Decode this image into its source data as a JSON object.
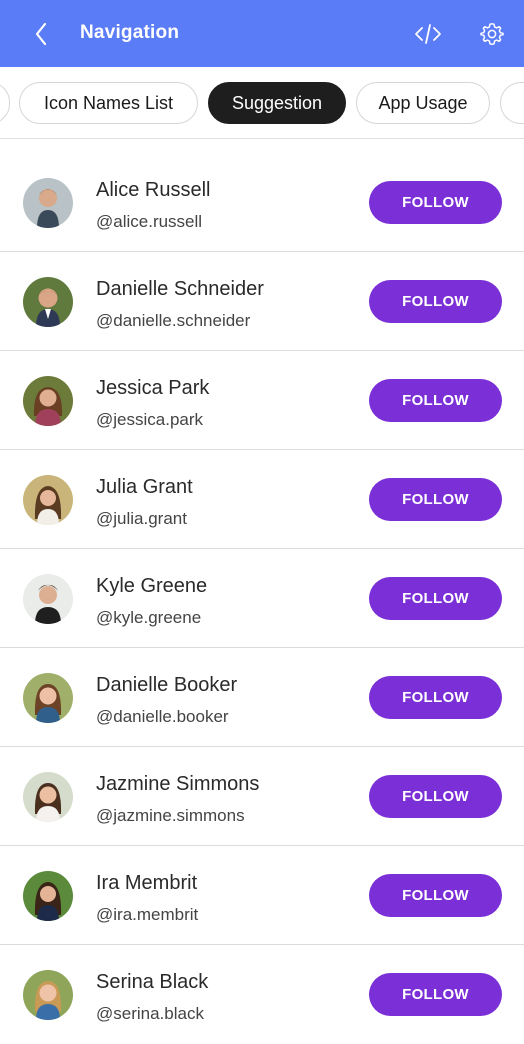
{
  "appbar": {
    "title": "Navigation",
    "back_icon": "chevron-left-icon",
    "code_icon": "code-icon",
    "settings_icon": "gear-icon",
    "color": "#5b7cf7"
  },
  "chips": [
    {
      "label": "Icon Names List",
      "active": false
    },
    {
      "label": "Suggestion",
      "active": true
    },
    {
      "label": "App Usage",
      "active": false
    }
  ],
  "follow_color": "#7b2fd6",
  "users": [
    {
      "name": "Alice Russell",
      "handle": "@alice.russell",
      "button": "FOLLOW"
    },
    {
      "name": "Danielle Schneider",
      "handle": "@danielle.schneider",
      "button": "FOLLOW"
    },
    {
      "name": "Jessica Park",
      "handle": "@jessica.park",
      "button": "FOLLOW"
    },
    {
      "name": "Julia Grant",
      "handle": "@julia.grant",
      "button": "FOLLOW"
    },
    {
      "name": "Kyle Greene",
      "handle": "@kyle.greene",
      "button": "FOLLOW"
    },
    {
      "name": "Danielle Booker",
      "handle": "@danielle.booker",
      "button": "FOLLOW"
    },
    {
      "name": "Jazmine Simmons",
      "handle": "@jazmine.simmons",
      "button": "FOLLOW"
    },
    {
      "name": "Ira Membrit",
      "handle": "@ira.membrit",
      "button": "FOLLOW"
    },
    {
      "name": "Serina Black",
      "handle": "@serina.black",
      "button": "FOLLOW"
    }
  ]
}
